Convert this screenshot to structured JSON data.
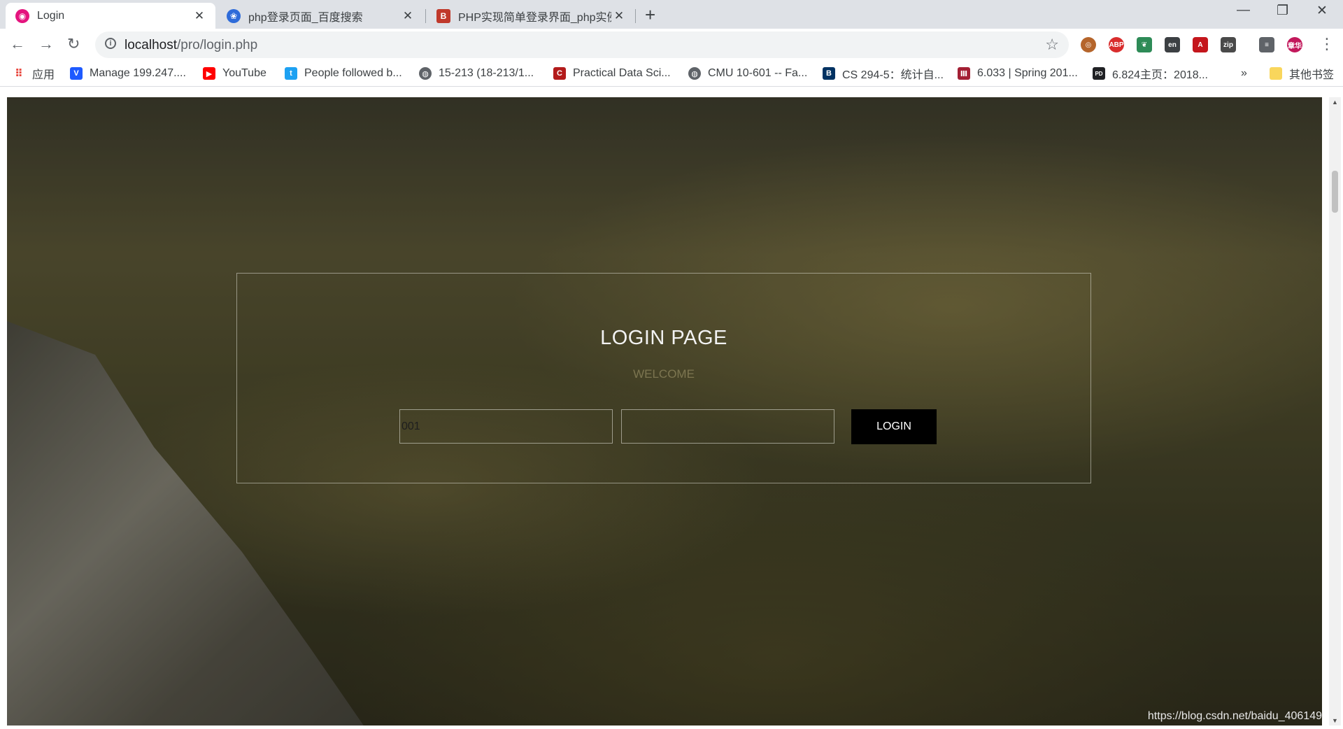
{
  "browser": {
    "tabs": [
      {
        "title": "Login",
        "close": "✕",
        "active": true
      },
      {
        "title": "php登录页面_百度搜索",
        "close": "✕",
        "active": false
      },
      {
        "title": "PHP实现简单登录界面_php实例",
        "close": "✕",
        "active": false
      }
    ],
    "new_tab": "+",
    "window_controls": {
      "minimize": "—",
      "restore": "❐",
      "close": "✕"
    },
    "url_host": "localhost",
    "url_path": "/pro/login.php",
    "profile_initials": "章华",
    "bookmarks": [
      {
        "label": "应用",
        "icon": "apps-grid-icon"
      },
      {
        "label": "Manage 199.247....",
        "icon": "vultr-icon"
      },
      {
        "label": "YouTube",
        "icon": "youtube-icon"
      },
      {
        "label": "People followed b...",
        "icon": "twitter-icon"
      },
      {
        "label": "15-213 (18-213/1...",
        "icon": "globe-icon"
      },
      {
        "label": "Practical Data Sci...",
        "icon": "cmu-icon"
      },
      {
        "label": "CMU 10-601 -- Fa...",
        "icon": "globe-icon"
      },
      {
        "label": "CS 294-5：统计自...",
        "icon": "berkeley-icon"
      },
      {
        "label": "6.033 | Spring 201...",
        "icon": "mit-icon"
      },
      {
        "label": "6.824主页：2018...",
        "icon": "pdos-icon"
      }
    ],
    "bookmarks_more": "»",
    "other_bookmarks": "其他书签"
  },
  "page": {
    "title": "LOGIN PAGE",
    "subtitle": "WELCOME",
    "username_value": "001",
    "password_value": "",
    "login_button": "LOGIN",
    "watermark": "https://blog.csdn.net/baidu_406149"
  }
}
